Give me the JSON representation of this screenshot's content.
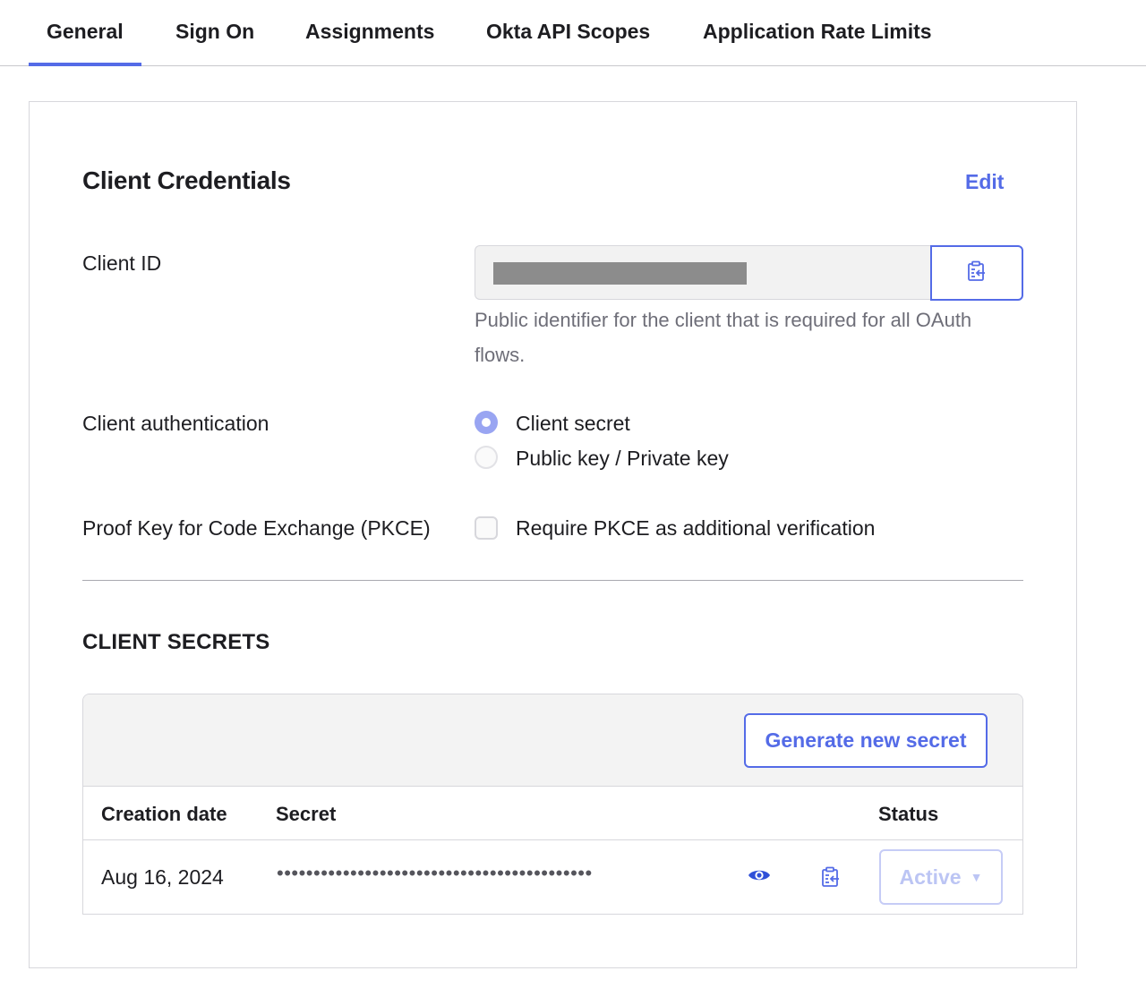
{
  "tabs": [
    {
      "label": "General",
      "active": true
    },
    {
      "label": "Sign On",
      "active": false
    },
    {
      "label": "Assignments",
      "active": false
    },
    {
      "label": "Okta API Scopes",
      "active": false
    },
    {
      "label": "Application Rate Limits",
      "active": false
    }
  ],
  "client_credentials": {
    "title": "Client Credentials",
    "edit_label": "Edit",
    "client_id_label": "Client ID",
    "client_id_help": "Public identifier for the client that is required for all OAuth flows.",
    "auth_label": "Client authentication",
    "auth_options": [
      {
        "label": "Client secret",
        "selected": true
      },
      {
        "label": "Public key / Private key",
        "selected": false
      }
    ],
    "pkce_label": "Proof Key for Code Exchange (PKCE)",
    "pkce_option": "Require PKCE as additional verification",
    "pkce_checked": false
  },
  "client_secrets": {
    "heading": "CLIENT SECRETS",
    "generate_label": "Generate new secret",
    "columns": [
      "Creation date",
      "Secret",
      "Status"
    ],
    "rows": [
      {
        "creation_date": "Aug 16, 2024",
        "secret_masked": "•••••••••••••••••••••••••••••••••••••••••••",
        "status": "Active"
      }
    ]
  },
  "colors": {
    "accent": "#546be7",
    "radio_selected": "#99a5f2",
    "help_text": "#6e6e78"
  },
  "icons": {
    "copy": "clipboard-copy-icon",
    "reveal": "eye-icon",
    "dropdown": "caret-down-icon"
  }
}
